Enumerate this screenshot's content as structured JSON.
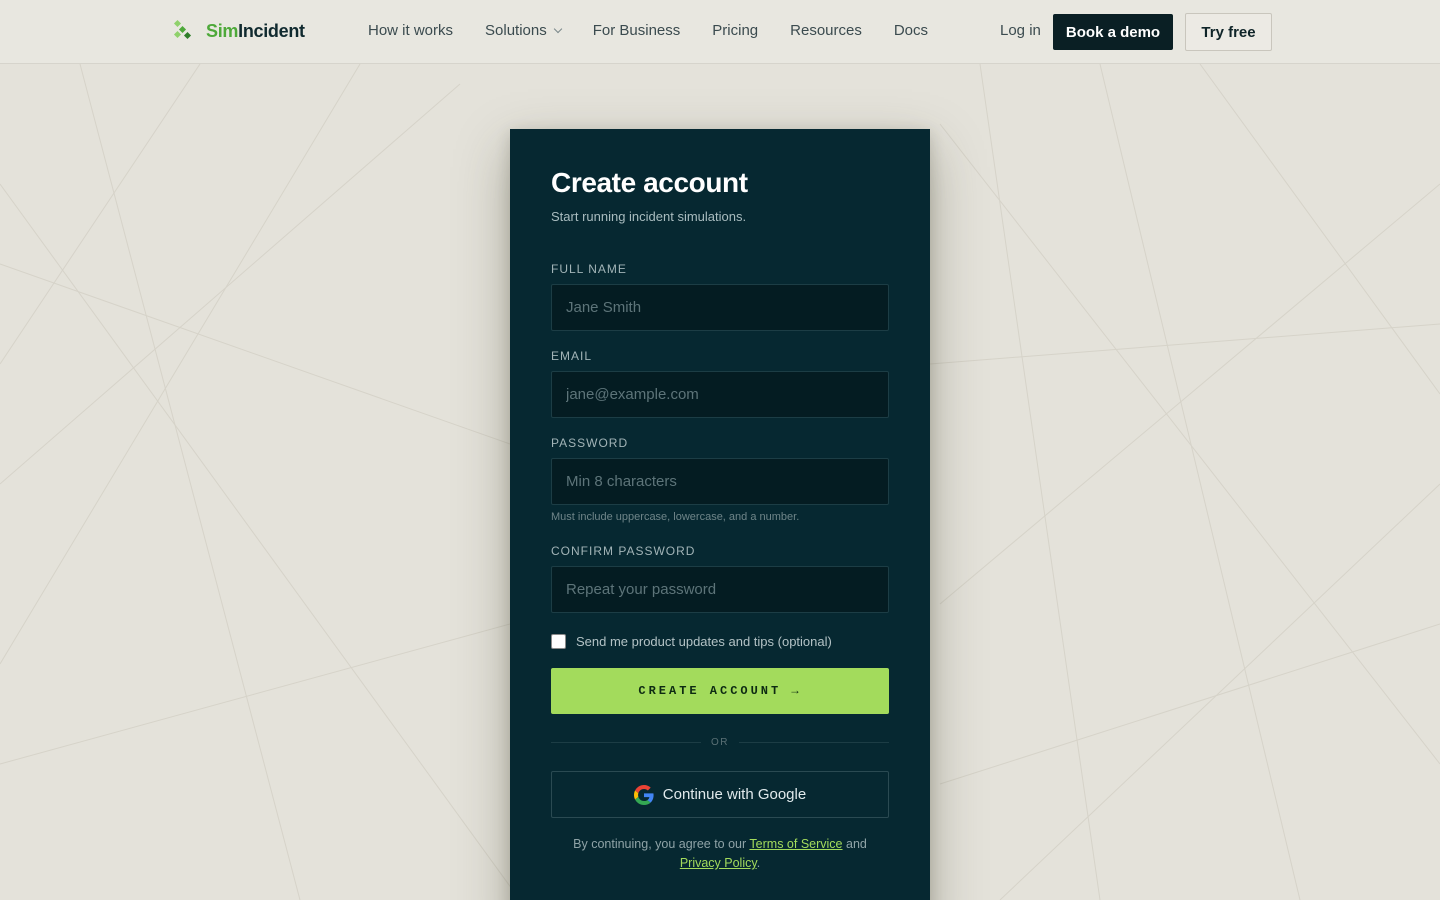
{
  "brand": {
    "name_part1": "Sim",
    "name_part2": "Incident",
    "accent": "#4ea93a"
  },
  "nav": {
    "items": [
      {
        "label": "How it works"
      },
      {
        "label": "Solutions",
        "has_dropdown": true
      },
      {
        "label": "For Business"
      },
      {
        "label": "Pricing"
      },
      {
        "label": "Resources"
      },
      {
        "label": "Docs"
      }
    ],
    "login": "Log in",
    "book_demo": "Book a demo",
    "try_free": "Try free"
  },
  "form": {
    "title": "Create account",
    "subtitle": "Start running incident simulations.",
    "full_name": {
      "label": "FULL NAME",
      "placeholder": "Jane Smith",
      "value": ""
    },
    "email": {
      "label": "EMAIL",
      "placeholder": "jane@example.com",
      "value": ""
    },
    "password": {
      "label": "PASSWORD",
      "placeholder": "Min 8 characters",
      "value": "",
      "hint": "Must include uppercase, lowercase, and a number."
    },
    "confirm_password": {
      "label": "CONFIRM PASSWORD",
      "placeholder": "Repeat your password",
      "value": ""
    },
    "updates_checkbox": {
      "label": "Send me product updates and tips (optional)",
      "checked": false
    },
    "submit": "CREATE ACCOUNT →",
    "divider": "OR",
    "google": "Continue with Google",
    "legal": {
      "prefix": "By continuing, you agree to our",
      "terms": "Terms of Service",
      "and": "and",
      "privacy": "Privacy Policy",
      "suffix": "."
    }
  },
  "colors": {
    "card_bg": "#062831",
    "cta_green": "#a3db5c",
    "page_bg": "#e4e2da",
    "dark_button": "#0a1f24"
  }
}
